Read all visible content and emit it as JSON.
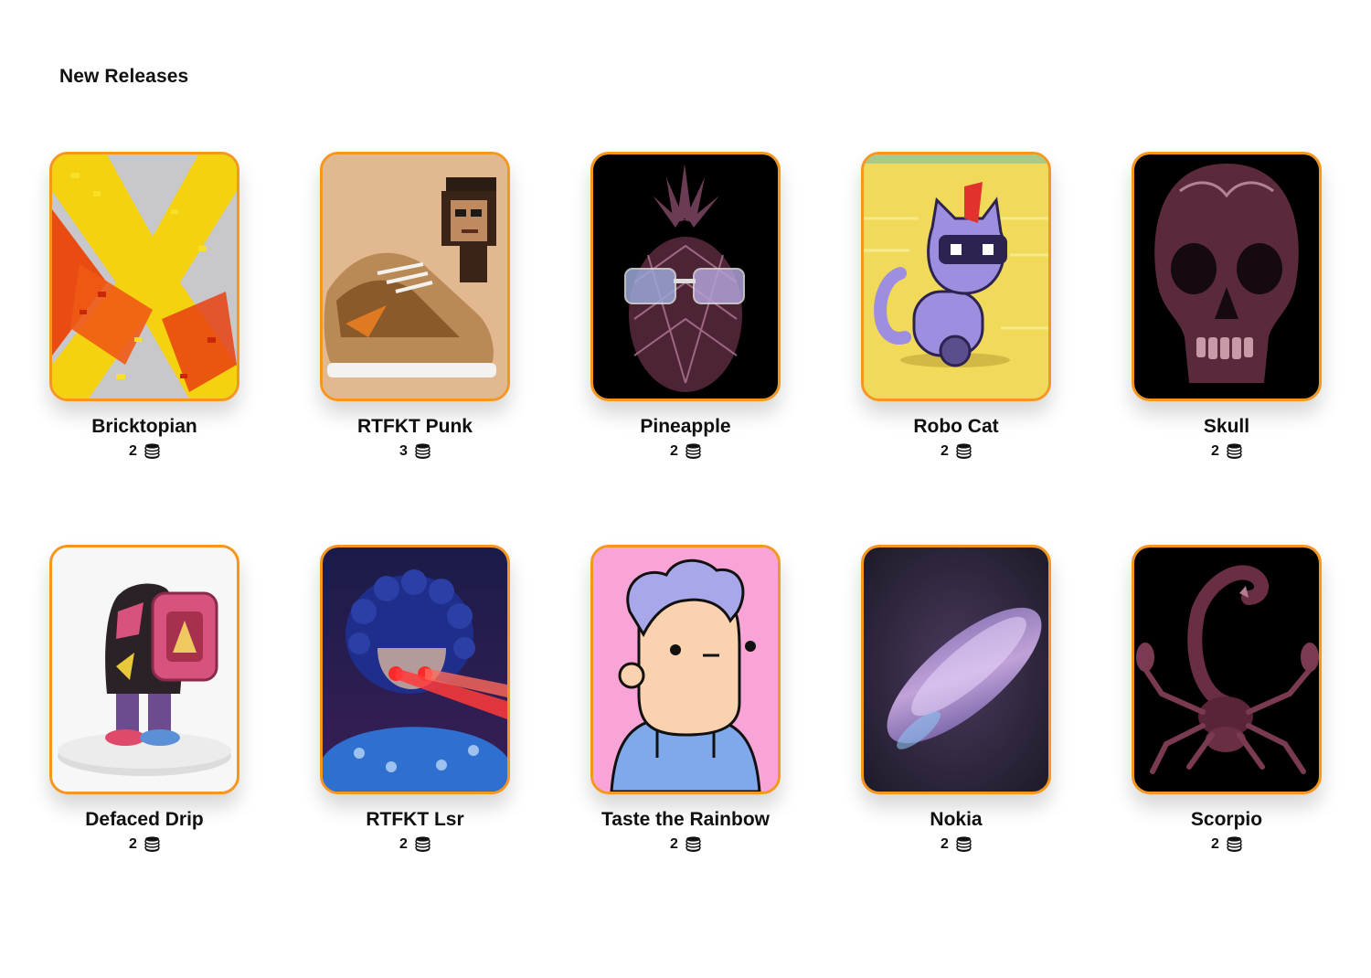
{
  "section": {
    "title": "New Releases"
  },
  "cards": [
    {
      "name": "Bricktopian",
      "price": "2",
      "art": "bricks-art"
    },
    {
      "name": "RTFKT Punk",
      "price": "3",
      "art": "sneaker-punk-art"
    },
    {
      "name": "Pineapple",
      "price": "2",
      "art": "pineapple-art"
    },
    {
      "name": "Robo Cat",
      "price": "2",
      "art": "robo-cat-art"
    },
    {
      "name": "Skull",
      "price": "2",
      "art": "skull-art"
    },
    {
      "name": "Defaced Drip",
      "price": "2",
      "art": "drip-figure-art"
    },
    {
      "name": "RTFKT Lsr",
      "price": "2",
      "art": "laser-eyes-art"
    },
    {
      "name": "Taste the Rainbow",
      "price": "2",
      "art": "cartoon-boy-art"
    },
    {
      "name": "Nokia",
      "price": "2",
      "art": "glass-disc-art"
    },
    {
      "name": "Scorpio",
      "price": "2",
      "art": "scorpion-art"
    }
  ],
  "colors": {
    "card_border": "#f5961f"
  },
  "icons": {
    "currency": "coins-icon"
  }
}
